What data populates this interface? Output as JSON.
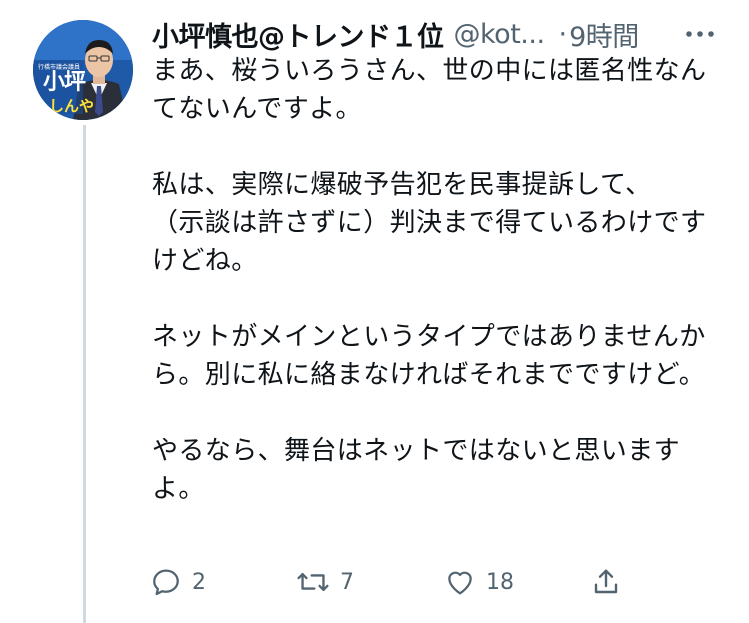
{
  "tweet": {
    "author": {
      "display_name": "小坪慎也@トレンド１位",
      "handle": "@kot...",
      "avatar": {
        "caption": "行橋市議会議員",
        "name": "小坪",
        "sub": "しんや"
      }
    },
    "separator": "·",
    "time": "9時間",
    "paragraphs": [
      "まあ、桜ういろうさん、世の中には匿名性なんてないんですよ。",
      "私は、実際に爆破予告犯を民事提訴して、\n（示談は許さずに）判決まで得ているわけですけどね。",
      "ネットがメインというタイプではありませんから。別に私に絡まなければそれまでですけど。",
      "やるなら、舞台はネットではないと思いますよ。"
    ],
    "actions": {
      "reply": {
        "icon": "reply-icon",
        "count": "2"
      },
      "retweet": {
        "icon": "retweet-icon",
        "count": "7"
      },
      "like": {
        "icon": "heart-icon",
        "count": "18"
      },
      "share": {
        "icon": "share-icon"
      }
    },
    "colors": {
      "text": "#0f1419",
      "secondary": "#536471",
      "thread_line": "#cfd9de",
      "avatar_bg": "#1f5aa8"
    }
  }
}
